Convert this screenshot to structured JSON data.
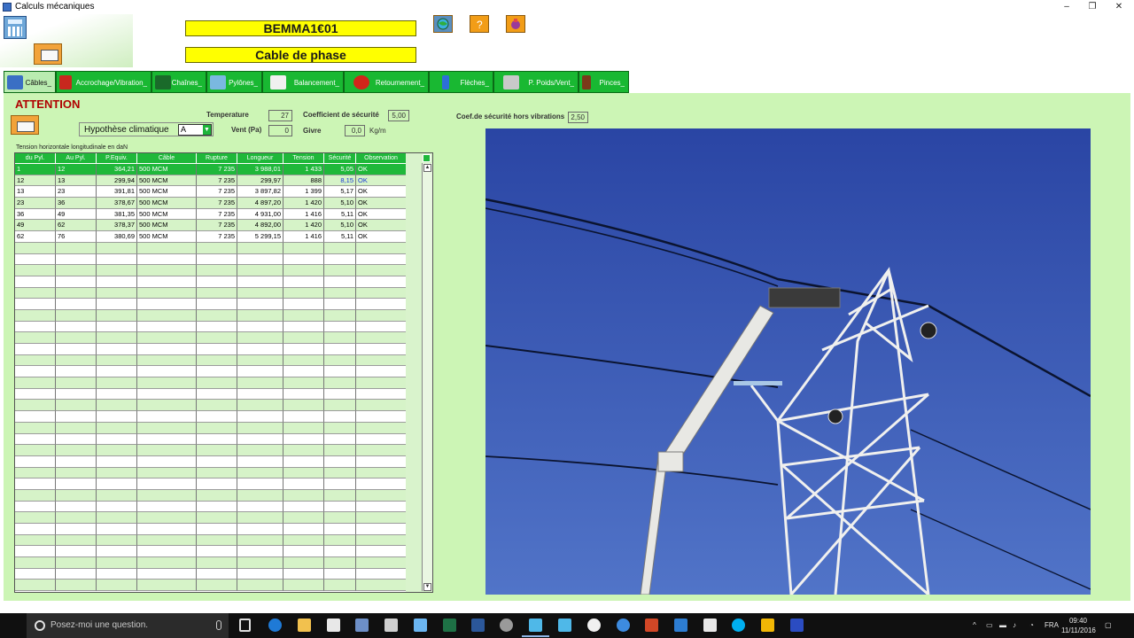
{
  "window": {
    "title": "Calculs mécaniques",
    "minimize": "–",
    "maximize": "❐",
    "close": "✕"
  },
  "header": {
    "code": "BEMMA1€01",
    "subtitle": "Cable de phase"
  },
  "tabs": [
    {
      "label": "Câbles_",
      "icon": "cable-icon",
      "color": "#3a6fc4"
    },
    {
      "label": "Accrochage/Vibration_",
      "icon": "vibration-icon",
      "color": "#c8281e"
    },
    {
      "label": "Chaînes_",
      "icon": "insulator-chain-icon",
      "color": "#1a6a2a"
    },
    {
      "label": "Pylônes_",
      "icon": "pylon-icon",
      "color": "#7ab8e0"
    },
    {
      "label": "Balancement_",
      "icon": "swing-hand-icon",
      "color": "#f0f0f0"
    },
    {
      "label": "Retournement_",
      "icon": "rotate-icon",
      "color": "#d2261a"
    },
    {
      "label": "Flèches_",
      "icon": "arrow-down-icon",
      "color": "#2d6fd8"
    },
    {
      "label": "P. Poids/Vent_",
      "icon": "weight-icon",
      "color": "#c9c9c9"
    },
    {
      "label": "Pinces_",
      "icon": "clamp-icon",
      "color": "#7a3a1a"
    }
  ],
  "main": {
    "attention": "ATTENTION",
    "hypothese": {
      "label": "Hypothèse climatique",
      "value": "A"
    },
    "temperature": {
      "label": "Temperature",
      "value": "27"
    },
    "vent": {
      "label": "Vent (Pa)",
      "value": "0"
    },
    "coef_securite": {
      "label": "Coefficient de sécurité",
      "value": "5,00"
    },
    "givre": {
      "label": "Givre",
      "value": "0,0",
      "unit": "Kg/m"
    },
    "coef_hors_vibrations": {
      "label": "Coef.de sécurité hors vibrations",
      "value": "2,50"
    }
  },
  "table": {
    "caption": "Tension horizontale longitudinale en daN",
    "columns": [
      "du Pyl.",
      "Au Pyl.",
      "P.Equiv.",
      "Câble",
      "Rupture",
      "Longueur",
      "Tension",
      "Sécurité",
      "Observation"
    ],
    "rows": [
      [
        "1",
        "12",
        "364,21",
        "500 MCM",
        "7 235",
        "3 988,01",
        "1 433",
        "5,05",
        "OK"
      ],
      [
        "12",
        "13",
        "299,94",
        "500 MCM",
        "7 235",
        "299,97",
        "888",
        "8,15",
        "OK"
      ],
      [
        "13",
        "23",
        "391,81",
        "500 MCM",
        "7 235",
        "3 897,82",
        "1 399",
        "5,17",
        "OK"
      ],
      [
        "23",
        "36",
        "378,67",
        "500 MCM",
        "7 235",
        "4 897,20",
        "1 420",
        "5,10",
        "OK"
      ],
      [
        "36",
        "49",
        "381,35",
        "500 MCM",
        "7 235",
        "4 931,00",
        "1 416",
        "5,11",
        "OK"
      ],
      [
        "49",
        "62",
        "378,37",
        "500 MCM",
        "7 235",
        "4 892,00",
        "1 420",
        "5,10",
        "OK"
      ],
      [
        "62",
        "76",
        "380,69",
        "500 MCM",
        "7 235",
        "5 299,15",
        "1 416",
        "5,11",
        "OK"
      ]
    ],
    "selected_row": 0,
    "highlight_row": 1,
    "scroll_up": "▲",
    "scroll_down": "▼"
  },
  "taskbar": {
    "search_placeholder": "Posez-moi une question.",
    "language": "FRA",
    "time": "09:40",
    "date": "11/11/2016"
  }
}
